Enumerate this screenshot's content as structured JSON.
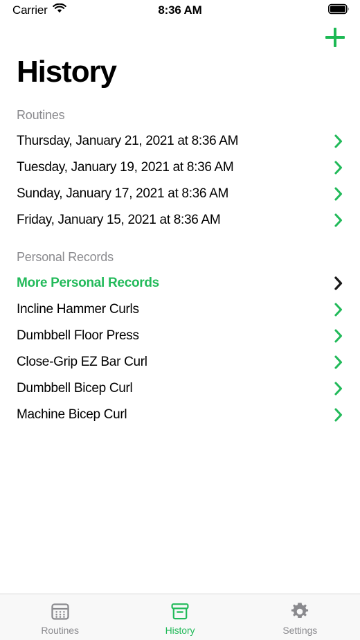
{
  "status_bar": {
    "carrier": "Carrier",
    "wifi_icon": "wifi-icon",
    "time": "8:36 AM",
    "battery_icon": "battery-full-icon"
  },
  "navbar": {
    "add_button_icon": "plus-icon",
    "add_button_label": "+"
  },
  "page_title": "History",
  "colors": {
    "accent_green": "#22BA5A",
    "plus_green": "#1DB954",
    "secondary_text": "#8A8A8E",
    "chevron_black": "#1A1A1A"
  },
  "sections": [
    {
      "header": "Routines",
      "rows": [
        {
          "label": "Thursday, January 21, 2021 at 8:36 AM",
          "chevron": "chevron-right-icon",
          "chevron_color": "#22BA5A",
          "accent": false
        },
        {
          "label": "Tuesday, January 19, 2021 at 8:36 AM",
          "chevron": "chevron-right-icon",
          "chevron_color": "#22BA5A",
          "accent": false
        },
        {
          "label": "Sunday, January 17, 2021 at 8:36 AM",
          "chevron": "chevron-right-icon",
          "chevron_color": "#22BA5A",
          "accent": false
        },
        {
          "label": "Friday, January 15, 2021 at 8:36 AM",
          "chevron": "chevron-right-icon",
          "chevron_color": "#22BA5A",
          "accent": false
        }
      ]
    },
    {
      "header": "Personal Records",
      "rows": [
        {
          "label": "More Personal Records",
          "chevron": "chevron-right-icon",
          "chevron_color": "#1A1A1A",
          "accent": true
        },
        {
          "label": "Incline Hammer Curls",
          "chevron": "chevron-right-icon",
          "chevron_color": "#22BA5A",
          "accent": false
        },
        {
          "label": "Dumbbell Floor Press",
          "chevron": "chevron-right-icon",
          "chevron_color": "#22BA5A",
          "accent": false
        },
        {
          "label": "Close-Grip EZ Bar Curl",
          "chevron": "chevron-right-icon",
          "chevron_color": "#22BA5A",
          "accent": false
        },
        {
          "label": "Dumbbell Bicep Curl",
          "chevron": "chevron-right-icon",
          "chevron_color": "#22BA5A",
          "accent": false
        },
        {
          "label": "Machine Bicep Curl",
          "chevron": "chevron-right-icon",
          "chevron_color": "#22BA5A",
          "accent": false
        }
      ]
    }
  ],
  "tabbar": {
    "tabs": [
      {
        "label": "Routines",
        "icon": "calendar-icon",
        "active": false
      },
      {
        "label": "History",
        "icon": "archive-box-icon",
        "active": true
      },
      {
        "label": "Settings",
        "icon": "gear-icon",
        "active": false
      }
    ]
  }
}
